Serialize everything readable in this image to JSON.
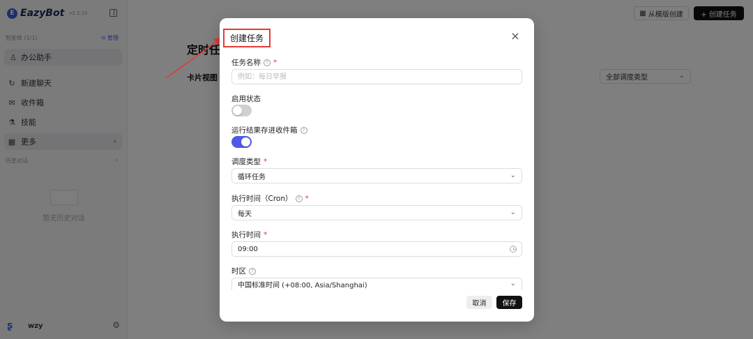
{
  "sidebar": {
    "brand": "EazyBot",
    "version": "v2.2.10",
    "agents_header": "智能体 (1/1)",
    "manage": "管理",
    "agent": "办公助手",
    "nav": [
      {
        "label": "新建聊天",
        "icon": "refresh-chat-icon"
      },
      {
        "label": "收件箱",
        "icon": "mail-icon"
      },
      {
        "label": "技能",
        "icon": "skills-icon"
      },
      {
        "label": "更多",
        "icon": "grid-icon"
      }
    ],
    "history_header": "历史对话",
    "empty_history": "暂无历史对话",
    "user": "wzy"
  },
  "main": {
    "create_from_template": "从模版创建",
    "create_task_button": "+ 创建任务",
    "page_title": "定时任",
    "view_label": "卡片视图",
    "type_filter": "全部调度类型"
  },
  "modal": {
    "title": "创建任务",
    "task_name_label": "任务名称",
    "task_name_placeholder": "例如：每日早报",
    "enable_label": "启用状态",
    "enable_on": false,
    "save_inbox_label": "运行结果存进收件箱",
    "save_inbox_on": true,
    "schedule_type_label": "调度类型",
    "schedule_type_value": "循环任务",
    "cron_label": "执行时间（Cron）",
    "cron_value": "每天",
    "exec_time_label": "执行时间",
    "exec_time_value": "09:00",
    "timezone_label": "时区",
    "timezone_value": "中国标准时间 (+08:00, Asia/Shanghai)",
    "cancel": "取消",
    "save": "保存"
  },
  "colors": {
    "accent": "#4f5ae8",
    "highlight_box": "#e53935",
    "primary_button": "#111111"
  }
}
